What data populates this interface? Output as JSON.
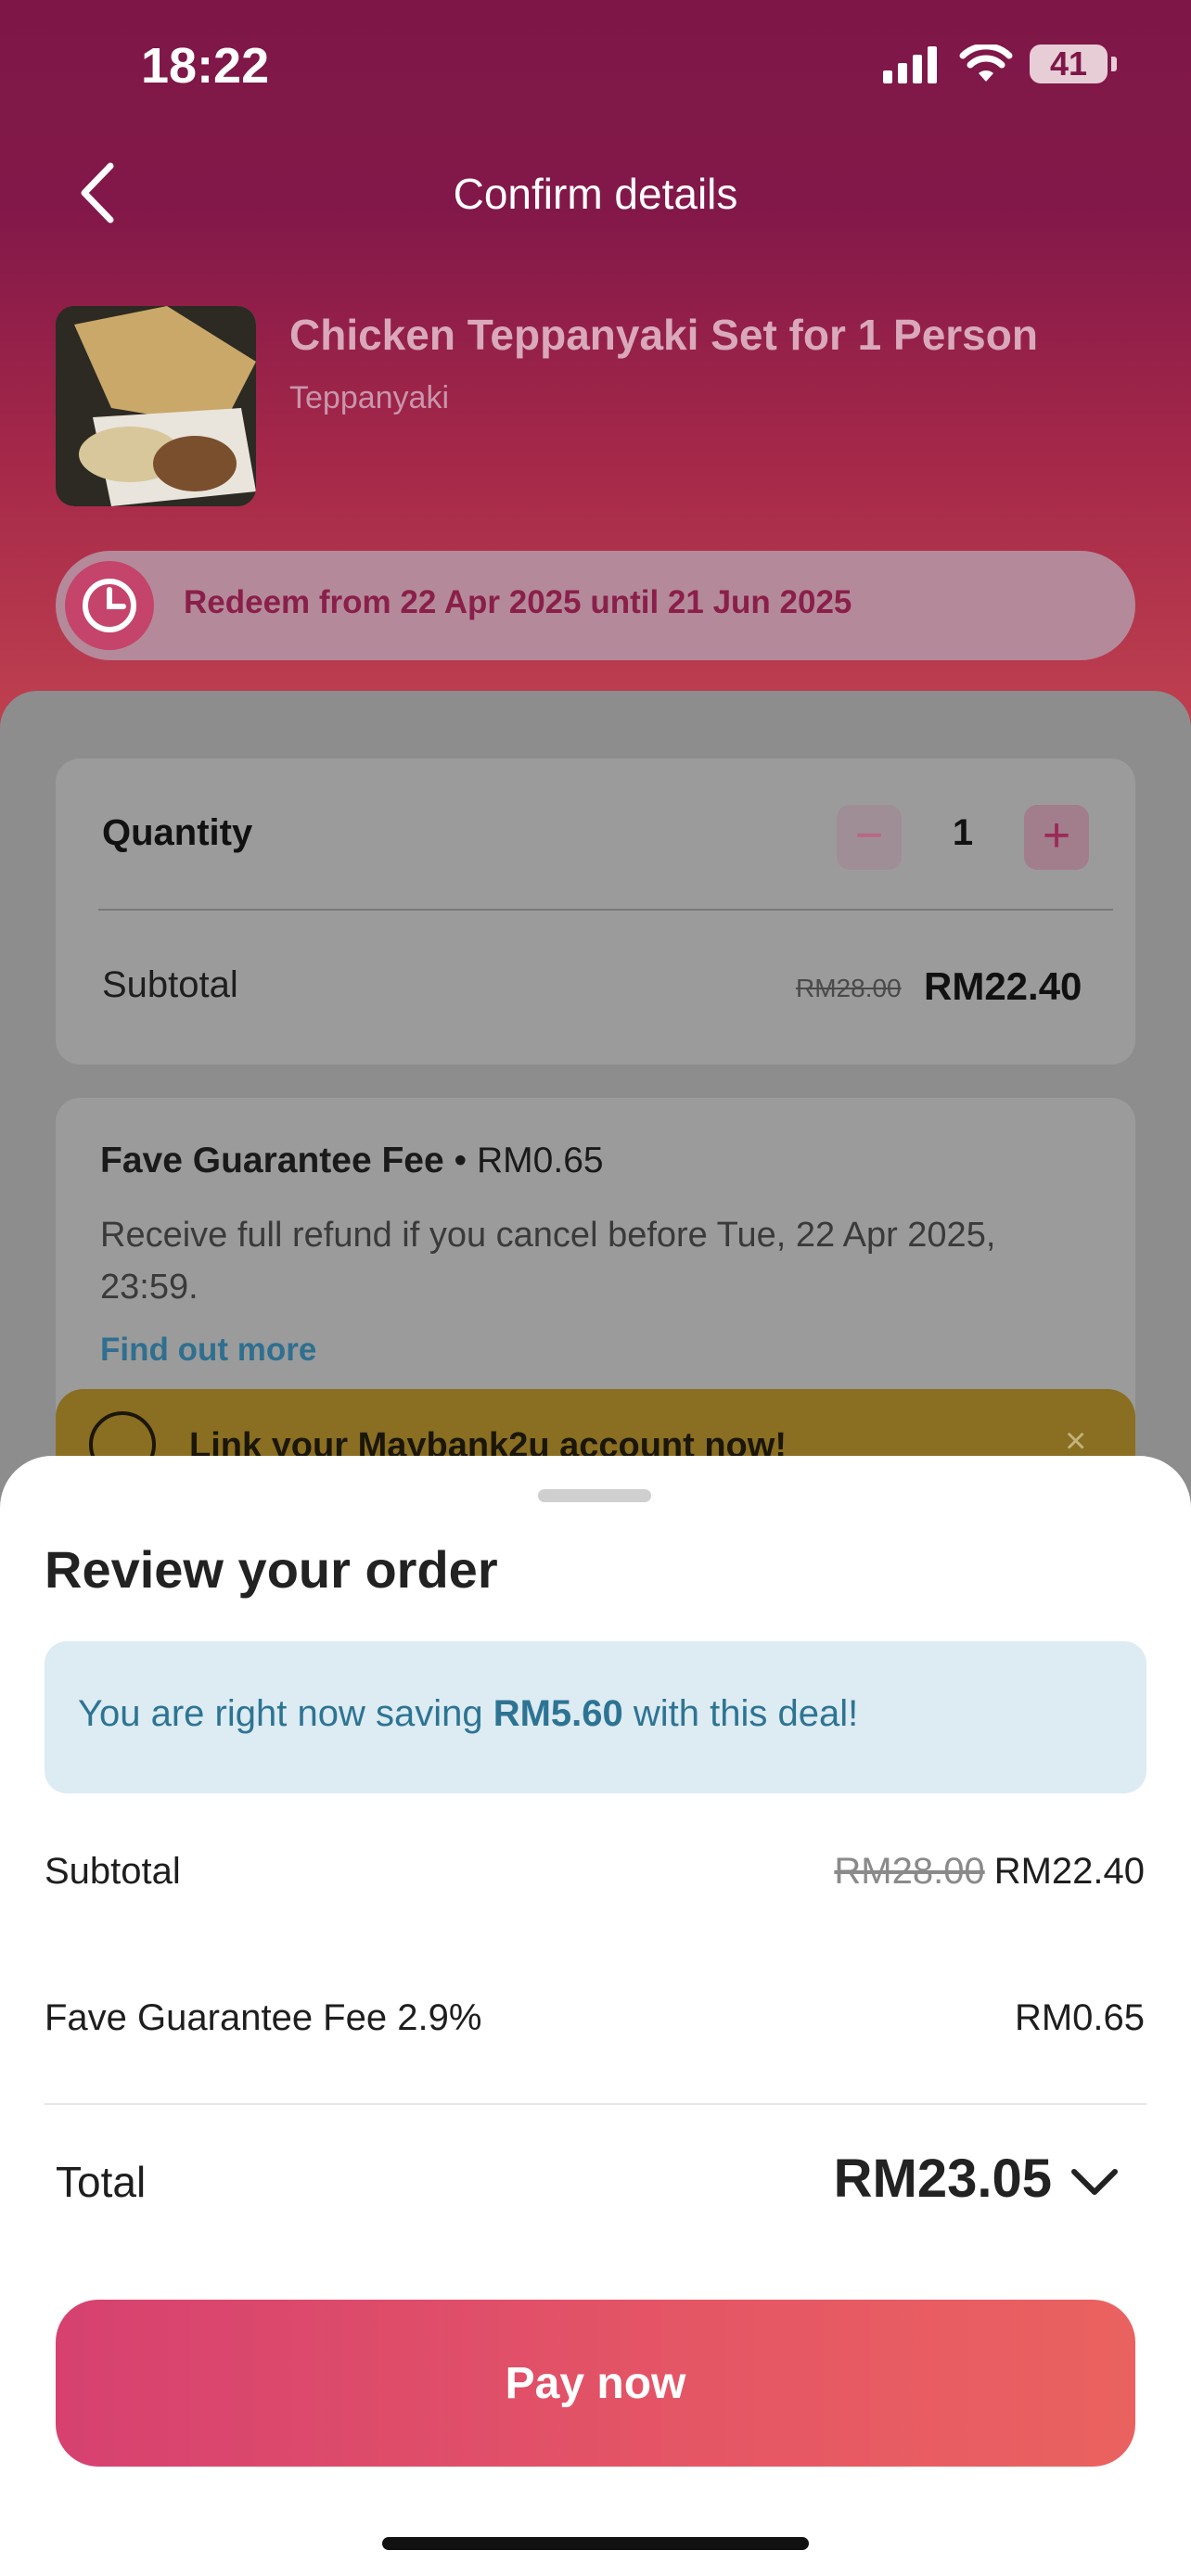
{
  "status_bar": {
    "time": "18:22",
    "battery": "41"
  },
  "nav": {
    "title": "Confirm details"
  },
  "product": {
    "name": "Chicken Teppanyaki Set for 1 Person",
    "category": "Teppanyaki"
  },
  "redeem": {
    "text": "Redeem from 22 Apr 2025 until 21 Jun 2025"
  },
  "quantity_card": {
    "label": "Quantity",
    "minus": "−",
    "value": "1",
    "plus": "+",
    "subtotal_label": "Subtotal",
    "subtotal_old": "RM28.00",
    "subtotal_new": "RM22.40"
  },
  "fee_card": {
    "title": "Fave Guarantee Fee",
    "separator": "•",
    "amount": "RM0.65",
    "description": "Receive full refund if you cancel before Tue, 22 Apr 2025, 23:59.",
    "link": "Find out more"
  },
  "maybank_banner": {
    "text": "Link your Maybank2u account now!",
    "close": "×"
  },
  "review_sheet": {
    "title": "Review your order",
    "saving_prefix": "You are right now saving ",
    "saving_amount": "RM5.60",
    "saving_suffix": " with this deal!",
    "subtotal_label": "Subtotal",
    "subtotal_old": "RM28.00",
    "subtotal_new": "RM22.40",
    "fee_label": "Fave Guarantee Fee 2.9%",
    "fee_value": "RM0.65",
    "total_label": "Total",
    "total_value": "RM23.05",
    "pay_button": "Pay now"
  },
  "colors": {
    "brand_dark": "#7e1747",
    "brand_gradient_end": "#ea6260",
    "link_blue": "#2d7493"
  }
}
